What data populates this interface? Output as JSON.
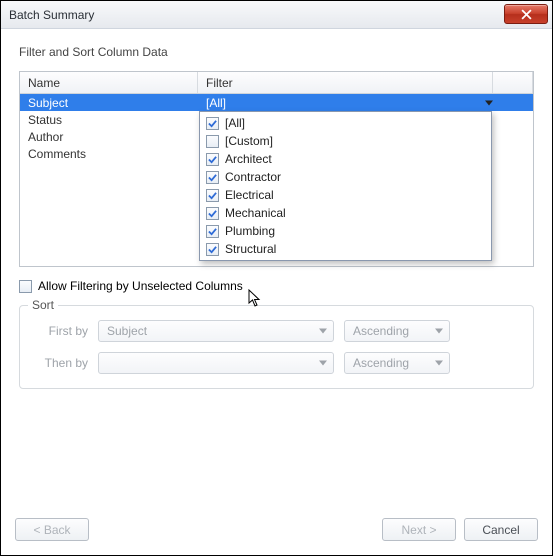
{
  "window": {
    "title": "Batch Summary"
  },
  "section_label": "Filter and Sort Column Data",
  "columns": {
    "name_header": "Name",
    "filter_header": "Filter"
  },
  "rows": [
    {
      "name": "Subject",
      "filter": "[All]",
      "selected": true
    },
    {
      "name": "Status",
      "filter": ""
    },
    {
      "name": "Author",
      "filter": ""
    },
    {
      "name": "Comments",
      "filter": ""
    }
  ],
  "dropdown": {
    "items": [
      {
        "label": "[All]",
        "checked": true
      },
      {
        "label": "[Custom]",
        "checked": false
      },
      {
        "label": "Architect",
        "checked": true
      },
      {
        "label": "Contractor",
        "checked": true
      },
      {
        "label": "Electrical",
        "checked": true
      },
      {
        "label": "Mechanical",
        "checked": true
      },
      {
        "label": "Plumbing",
        "checked": true
      },
      {
        "label": "Structural",
        "checked": true
      }
    ]
  },
  "allow_filtering": {
    "label": "Allow Filtering by Unselected Columns",
    "checked": false
  },
  "sort": {
    "legend": "Sort",
    "first_label": "First by",
    "then_label": "Then by",
    "first_value": "Subject",
    "then_value": "",
    "order_first": "Ascending",
    "order_then": "Ascending"
  },
  "buttons": {
    "back": "< Back",
    "next": "Next >",
    "cancel": "Cancel"
  }
}
